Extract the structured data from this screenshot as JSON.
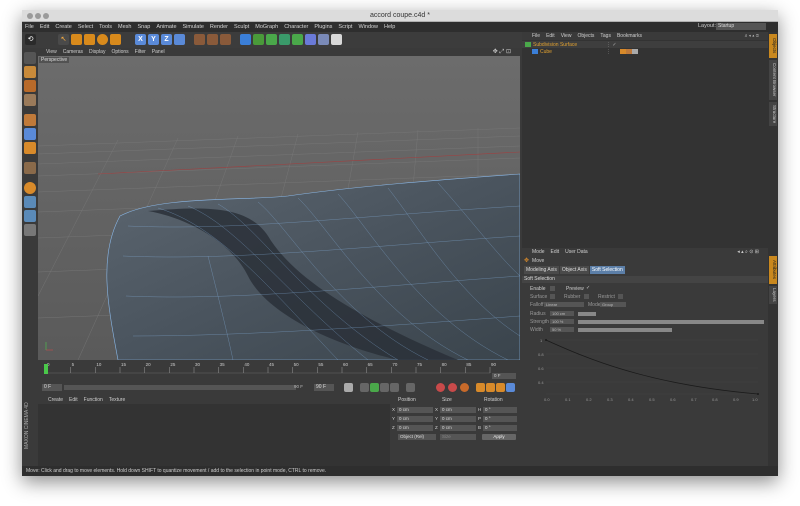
{
  "window": {
    "title": "accord coupe.c4d *"
  },
  "menubar": [
    "File",
    "Edit",
    "Create",
    "Select",
    "Tools",
    "Mesh",
    "Snap",
    "Animate",
    "Simulate",
    "Render",
    "Sculpt",
    "MoGraph",
    "Character",
    "Plugins",
    "Script",
    "Window",
    "Help"
  ],
  "layout": {
    "label": "Layout:",
    "value": "Startup"
  },
  "toolbar": {
    "axis": [
      "X",
      "Y",
      "Z"
    ]
  },
  "viewport": {
    "menu": [
      "View",
      "Cameras",
      "Display",
      "Options",
      "Filter",
      "Panel"
    ],
    "label": "Perspective"
  },
  "timeline": {
    "ticks": [
      "0",
      "5",
      "10",
      "15",
      "20",
      "25",
      "30",
      "35",
      "40",
      "45",
      "50",
      "55",
      "60",
      "65",
      "70",
      "75",
      "80",
      "85",
      "90"
    ],
    "end_frame": "0 F"
  },
  "transport": {
    "start": "0 F",
    "current": "90 F",
    "end": "90 F"
  },
  "materials": {
    "menu": [
      "Create",
      "Edit",
      "Function",
      "Texture"
    ]
  },
  "maxon_logo": "MAXON CINEMA 4D",
  "coordinates": {
    "headers": [
      "Position",
      "Size",
      "Rotation"
    ],
    "rows": [
      {
        "axis": "X",
        "pos": "0 cm",
        "size_axis": "X",
        "size": "0 cm",
        "rot_axis": "H",
        "rot": "0 °"
      },
      {
        "axis": "Y",
        "pos": "0 cm",
        "size_axis": "Y",
        "size": "0 cm",
        "rot_axis": "P",
        "rot": "0 °"
      },
      {
        "axis": "Z",
        "pos": "0 cm",
        "size_axis": "Z",
        "size": "0 cm",
        "rot_axis": "B",
        "rot": "0 °"
      }
    ],
    "mode": "Object (Rel)",
    "size_mode": "Size",
    "apply": "Apply"
  },
  "objects": {
    "menu": [
      "File",
      "Edit",
      "View",
      "Objects",
      "Tags",
      "Bookmarks"
    ],
    "items": [
      {
        "name": "Subdivision Surface",
        "color": "#e0a030"
      },
      {
        "name": "Cube",
        "color": "#e0a030"
      }
    ]
  },
  "attributes": {
    "menu": [
      "Mode",
      "Edit",
      "User Data"
    ],
    "tool": "Move",
    "tabs": [
      "Modeling Axis",
      "Object Axis",
      "Soft Selection"
    ],
    "active_tab": "Soft Selection",
    "section": "Soft Selection",
    "enable": "Enable",
    "preview": "Preview",
    "surface": "Surface",
    "rubber": "Rubber",
    "restrict": "Restrict",
    "falloff_label": "Falloff",
    "falloff_value": "Linear",
    "mode_label": "Mode",
    "mode_value": "Group",
    "radius_label": "Radius",
    "radius_value": "100 cm",
    "strength_label": "Strength",
    "strength_value": "100 %",
    "width_label": "Width",
    "width_value": "50 %",
    "graph_y": [
      "1",
      "0.8",
      "0.6",
      "0.4"
    ],
    "graph_x": [
      "0.0",
      "0.1",
      "0.2",
      "0.3",
      "0.4",
      "0.5",
      "0.6",
      "0.7",
      "0.8",
      "0.9",
      "1.0"
    ]
  },
  "right_tabs": [
    "Objects",
    "Content Browser",
    "Structure",
    "Attributes",
    "Layers"
  ],
  "status": "Move: Click and drag to move elements. Hold down SHIFT to quantize movement / add to the selection in point mode, CTRL to remove."
}
